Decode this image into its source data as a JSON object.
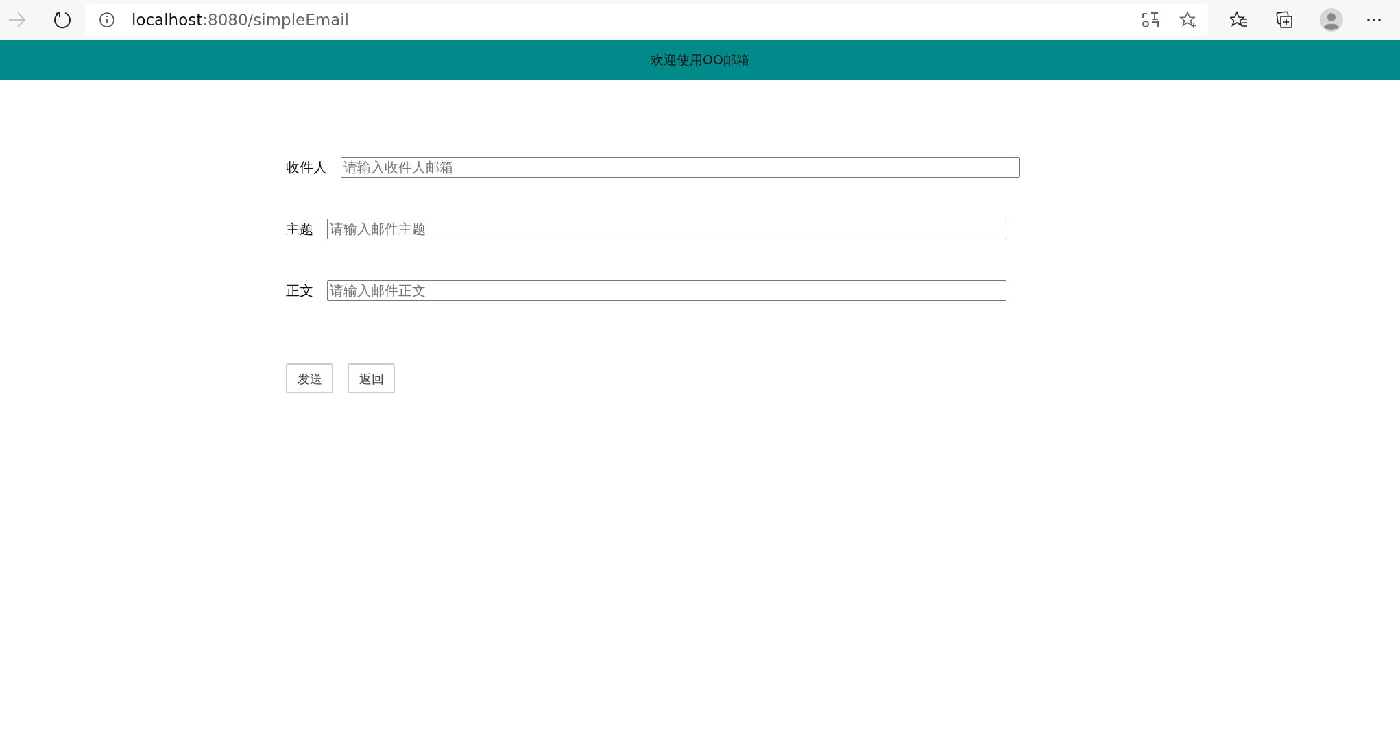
{
  "browser": {
    "address_host": "localhost",
    "address_path": ":8080/simpleEmail"
  },
  "header": {
    "title": "欢迎使用OO邮箱"
  },
  "form": {
    "fields": [
      {
        "label": "收件人",
        "placeholder": "请输入收件人邮箱"
      },
      {
        "label": "主题",
        "placeholder": "请输入邮件主题"
      },
      {
        "label": "正文",
        "placeholder": "请输入邮件正文"
      }
    ],
    "buttons": [
      "发送",
      "返回"
    ]
  }
}
